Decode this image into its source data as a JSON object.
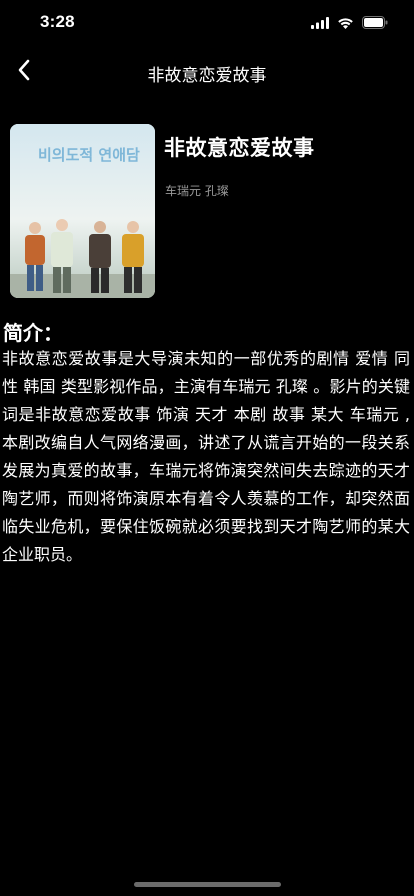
{
  "status_bar": {
    "time": "3:28",
    "icons": [
      "signal-icon",
      "wifi-icon",
      "battery-icon"
    ]
  },
  "nav": {
    "back_icon": "chevron-left-icon",
    "title": "非故意恋爱故事"
  },
  "movie": {
    "title": "非故意恋爱故事",
    "cast": "车瑞元 孔璨",
    "poster_text": "비의도적 연애담"
  },
  "intro": {
    "heading": "简介：",
    "body": "非故意恋爱故事是大导演未知的一部优秀的剧情 爱情 同性 韩国 类型影视作品，主演有车瑞元 孔璨 。影片的关键词是非故意恋爱故事 饰演 天才 本剧 故事 某大 车瑞元 ,本剧改编自人气网络漫画，讲述了从谎言开始的一段关系发展为真爱的故事，车瑞元将饰演突然间失去踪迹的天才陶艺师，而则将饰演原本有着令人羡慕的工作，却突然面临失业危机，要保住饭碗就必须要找到天才陶艺师的某大企业职员。"
  },
  "colors": {
    "background": "#000000",
    "text": "#ffffff",
    "secondary_text": "#9a9a9a",
    "poster_title": "#7fb7d8"
  }
}
